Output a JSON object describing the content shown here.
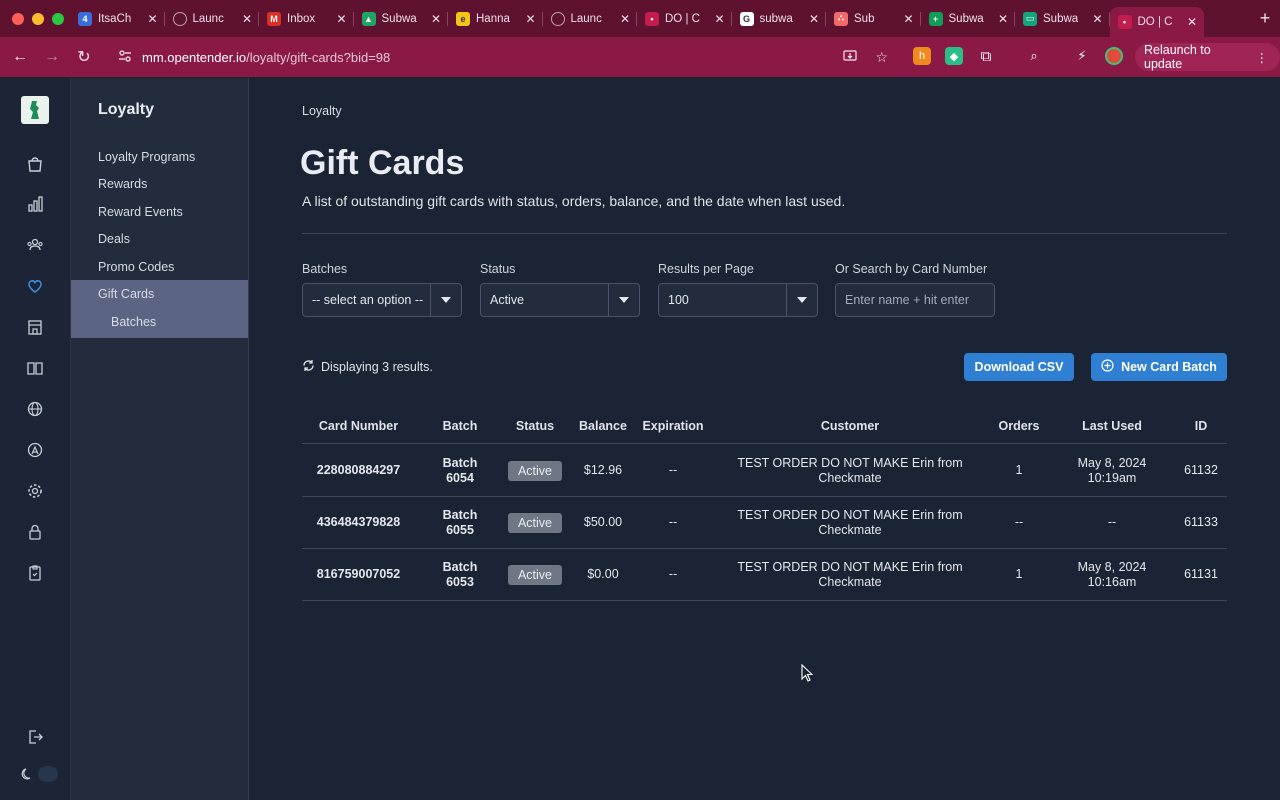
{
  "browser": {
    "tabs": [
      {
        "title": "ItsaCh",
        "favicon": "itsacheckmate-icon",
        "color": "#3b6fd8",
        "glyph": "4"
      },
      {
        "title": "Launc",
        "favicon": "globe-icon",
        "color": "#6b7280",
        "glyph": ""
      },
      {
        "title": "Inbox",
        "favicon": "gmail-icon",
        "color": "#d93025",
        "glyph": "M"
      },
      {
        "title": "Subwa",
        "favicon": "google-drive-icon",
        "color": "#1fa463",
        "glyph": "▲"
      },
      {
        "title": "Hanna",
        "favicon": "mailchimp-icon",
        "color": "#f5c518",
        "glyph": "e"
      },
      {
        "title": "Launc",
        "favicon": "globe-icon",
        "color": "#6b7280",
        "glyph": ""
      },
      {
        "title": "DO | C",
        "favicon": "opentender-icon",
        "color": "#c21d4e",
        "glyph": "•"
      },
      {
        "title": "subwa",
        "favicon": "google-icon",
        "color": "#ffffff",
        "glyph": "G"
      },
      {
        "title": "Sub",
        "favicon": "asana-icon",
        "color": "#f06a6a",
        "glyph": "∴"
      },
      {
        "title": "Subwa",
        "favicon": "google-sheets-icon",
        "color": "#0f9d58",
        "glyph": "+"
      },
      {
        "title": "Subwa",
        "favicon": "window-icon",
        "color": "#14a37f",
        "glyph": "▭"
      },
      {
        "title": "DO | C",
        "favicon": "opentender-icon",
        "color": "#c21d4e",
        "glyph": "•",
        "active": true
      }
    ],
    "url_host": "mm.opentender.io",
    "url_path": "/loyalty/gift-cards?bid=98",
    "relaunch_label": "Relaunch to update"
  },
  "subnav": {
    "title": "Loyalty",
    "items": [
      "Loyalty Programs",
      "Rewards",
      "Reward Events",
      "Deals",
      "Promo Codes",
      "Gift Cards"
    ],
    "subitem": "Batches",
    "active": "Gift Cards"
  },
  "page": {
    "breadcrumb": "Loyalty",
    "title": "Gift Cards",
    "subtitle": "A list of outstanding gift cards with status, orders, balance, and the date when last used."
  },
  "filters": {
    "batches_label": "Batches",
    "batches_value": "-- select an option --",
    "status_label": "Status",
    "status_value": "Active",
    "per_page_label": "Results per Page",
    "per_page_value": "100",
    "search_label": "Or Search by Card Number",
    "search_placeholder": "Enter name + hit enter"
  },
  "results_text": "Displaying 3 results.",
  "actions": {
    "download": "Download CSV",
    "new_batch": "New Card Batch"
  },
  "table": {
    "headers": [
      "Card Number",
      "Batch",
      "Status",
      "Balance",
      "Expiration",
      "Customer",
      "Orders",
      "Last Used",
      "ID"
    ],
    "rows": [
      {
        "card": "228080884297",
        "batch1": "Batch",
        "batch2": "6054",
        "status": "Active",
        "balance": "$12.96",
        "expiration": "--",
        "cust1": "TEST ORDER DO NOT MAKE Erin from",
        "cust2": "Checkmate",
        "orders": "1",
        "used1": "May 8, 2024",
        "used2": "10:19am",
        "id": "61132"
      },
      {
        "card": "436484379828",
        "batch1": "Batch",
        "batch2": "6055",
        "status": "Active",
        "balance": "$50.00",
        "expiration": "--",
        "cust1": "TEST ORDER DO NOT MAKE Erin from",
        "cust2": "Checkmate",
        "orders": "--",
        "used1": "--",
        "used2": "",
        "id": "61133"
      },
      {
        "card": "816759007052",
        "batch1": "Batch",
        "batch2": "6053",
        "status": "Active",
        "balance": "$0.00",
        "expiration": "--",
        "cust1": "TEST ORDER DO NOT MAKE Erin from",
        "cust2": "Checkmate",
        "orders": "1",
        "used1": "May 8, 2024",
        "used2": "10:16am",
        "id": "61131"
      }
    ]
  },
  "colors": {
    "accent": "#2f7fd3",
    "active_nav": "#5b6483",
    "browser_frame": "#8a1a45",
    "favorite_icon": "#3b8fe0"
  }
}
